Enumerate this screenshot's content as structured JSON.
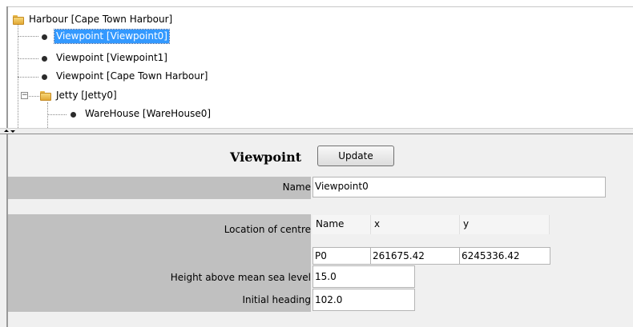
{
  "tree": {
    "nodes": [
      {
        "label": "Harbour [Cape Town Harbour]",
        "kind": "folder",
        "selected": false
      },
      {
        "label": "Viewpoint [Viewpoint0]",
        "kind": "leaf",
        "selected": true
      },
      {
        "label": "Viewpoint [Viewpoint1]",
        "kind": "leaf",
        "selected": false
      },
      {
        "label": "Viewpoint [Cape Town Harbour]",
        "kind": "leaf",
        "selected": false
      },
      {
        "label": "Jetty [Jetty0]",
        "kind": "folder",
        "expanded": true,
        "selected": false
      },
      {
        "label": "WareHouse [WareHouse0]",
        "kind": "leaf",
        "selected": false
      }
    ],
    "colors": {
      "selection": "#3399ff",
      "folder": "#e2a936"
    }
  },
  "form": {
    "title": "Viewpoint",
    "update_label": "Update",
    "name_label": "Name",
    "name_value": "Viewpoint0",
    "location_label": "Location of centre",
    "location_table": {
      "headers": [
        "Name",
        "x",
        "y"
      ],
      "rows": [
        [
          "P0",
          "261675.42",
          "6245336.42"
        ]
      ]
    },
    "height_label": "Height above mean sea level",
    "height_value": "15.0",
    "heading_label": "Initial heading",
    "heading_value": "102.0"
  }
}
